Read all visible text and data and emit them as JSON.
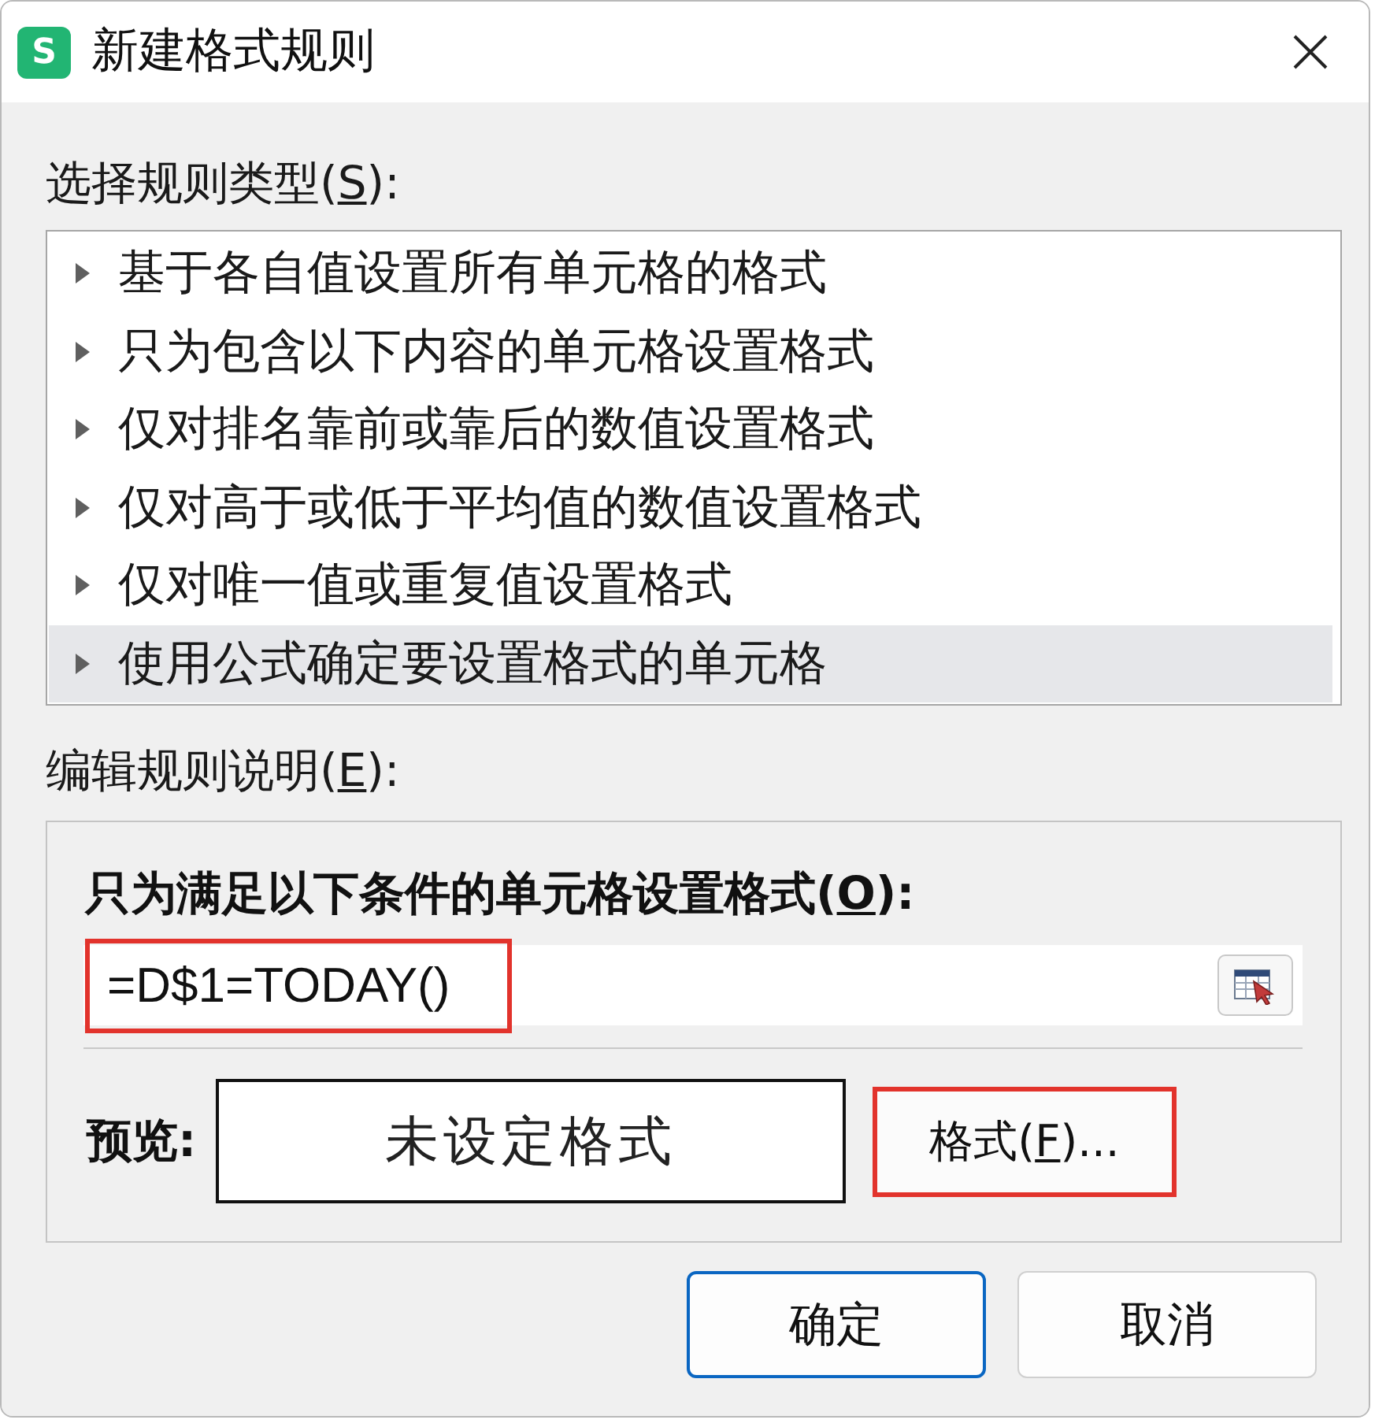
{
  "window": {
    "logo_text": "S",
    "title": "新建格式规则"
  },
  "rule_type": {
    "label": {
      "before": "选择规则类型(",
      "access_key": "S",
      "after": "):"
    },
    "items": [
      {
        "label": "基于各自值设置所有单元格的格式",
        "selected": false
      },
      {
        "label": "只为包含以下内容的单元格设置格式",
        "selected": false
      },
      {
        "label": "仅对排名靠前或靠后的数值设置格式",
        "selected": false
      },
      {
        "label": "仅对高于或低于平均值的数值设置格式",
        "selected": false
      },
      {
        "label": "仅对唯一值或重复值设置格式",
        "selected": false
      },
      {
        "label": "使用公式确定要设置格式的单元格",
        "selected": true
      }
    ]
  },
  "rule_description": {
    "label": {
      "before": "编辑规则说明(",
      "access_key": "E",
      "after": "):"
    },
    "condition_label": {
      "before": "只为满足以下条件的单元格设置格式(",
      "access_key": "O",
      "after": "):"
    },
    "formula": {
      "value": "=D$1=TODAY()",
      "highlighted": true
    },
    "preview_label": "预览:",
    "preview_text": "未设定格式",
    "format_button": {
      "label": {
        "before": "格式(",
        "access_key": "F",
        "after": ")..."
      },
      "highlighted": true
    }
  },
  "buttons": [
    {
      "label": "确定",
      "default": true
    },
    {
      "label": "取消",
      "default": false
    }
  ]
}
